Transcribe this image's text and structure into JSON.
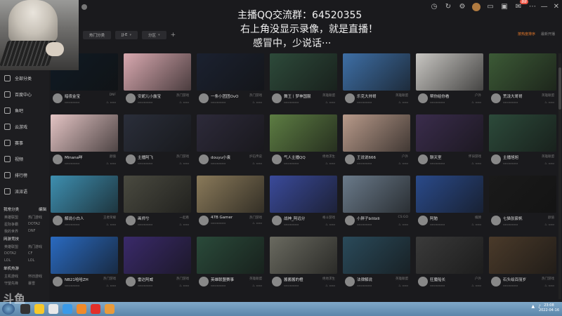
{
  "announcement": {
    "line1": "主播QQ交流群：64520355",
    "line2": "右上角没显示录像，就是直播！",
    "line3": "感冒中，少说话···"
  },
  "topbar": {
    "notification_count": "88"
  },
  "sidebar": {
    "items": [
      "全部分类",
      "百度中心",
      "鱼吧",
      "云游戏",
      "赛事",
      "视频",
      "排行榜",
      "派派语"
    ],
    "sections": [
      {
        "title": "我常分类",
        "action": "编辑",
        "rows": [
          [
            "英雄联盟",
            "热门游戏"
          ],
          [
            "星际争霸",
            "DOTA2"
          ],
          [
            "我的世界",
            "DNF"
          ]
        ]
      },
      {
        "title": "网游竞技",
        "action": "",
        "rows": [
          [
            "英雄联盟",
            "热门游戏"
          ],
          [
            "DOTA2",
            "CF"
          ],
          [
            "LOL",
            "LOL"
          ]
        ]
      },
      {
        "title": "单机热游",
        "action": "",
        "rows": [
          [
            "主机游戏",
            "怀旧游戏"
          ],
          [
            "守望先锋",
            "暴雪"
          ]
        ]
      }
    ]
  },
  "filters": {
    "chips": [
      "热门分类",
      "JJ-E",
      "分区"
    ],
    "right_tabs": [
      "按热度排序",
      "最新开播"
    ]
  },
  "watermark": "斗鱼",
  "clock": {
    "time": "23:08",
    "date": "2022-04-16"
  },
  "cards": [
    {
      "name": "暗夜金宝",
      "cat": "DNF",
      "bg": "#101a24"
    },
    {
      "name": "安妮儿小露宝",
      "cat": "热门游戏",
      "bg": "#d9a9b0"
    },
    {
      "name": "一条小团团OvO",
      "cat": "热门游戏",
      "bg": "#1b2130"
    },
    {
      "name": "舞王丨梦神国服",
      "cat": "英雄联盟",
      "bg": "#2d4a3a"
    },
    {
      "name": "乐克大帅哥",
      "cat": "英雄联盟",
      "bg": "#3e6fa6"
    },
    {
      "name": "帮你给你看",
      "cat": "户外",
      "bg": "#c8c6c2"
    },
    {
      "name": "荒泷大哥哥",
      "cat": "英雄联盟",
      "bg": "#3c5a36"
    },
    {
      "name": "Minana咩",
      "cat": "颜值",
      "bg": "#e4c4c4"
    },
    {
      "name": "主播阿飞",
      "cat": "热门游戏",
      "bg": "#2a2e3a"
    },
    {
      "name": "douyu小袁",
      "cat": "炉石传说",
      "bg": "#2d2a3a"
    },
    {
      "name": "气人主播QQ",
      "cat": "绝地求生",
      "bg": "#5d7d43"
    },
    {
      "name": "王说说666",
      "cat": "户外",
      "bg": "#b89a8a"
    },
    {
      "name": "聊天室",
      "cat": "怀旧游戏",
      "bg": "#3a2c4c"
    },
    {
      "name": "主播旭旭",
      "cat": "英雄联盟",
      "bg": "#2c4a3a"
    },
    {
      "name": "解说小白人",
      "cat": "王者荣耀",
      "bg": "#3e8fb0"
    },
    {
      "name": "画师兮",
      "cat": "一起看",
      "bg": "#4a4a40"
    },
    {
      "name": "47B Gamer",
      "cat": "热门游戏",
      "bg": "#8a7a5a"
    },
    {
      "name": "战神_阿远分",
      "cat": "格斗游戏",
      "bg": "#3a4a9a"
    },
    {
      "name": "小胖子bilibili",
      "cat": "CS:GO",
      "bg": "#6a7a8a"
    },
    {
      "name": "阿勉",
      "cat": "棋牌",
      "bg": "#2a4a8a"
    },
    {
      "name": "七猫张宸帆",
      "cat": "颜值",
      "bg": "#1a1a1a"
    },
    {
      "name": "NB21哈哈ZH",
      "cat": "热门游戏",
      "bg": "#2a6ac0"
    },
    {
      "name": "雷达阿威",
      "cat": "热门游戏",
      "bg": "#3a2a6a"
    },
    {
      "name": "英雄联盟赛事",
      "cat": "英雄联盟",
      "bg": "#2a4a3a"
    },
    {
      "name": "酱酱酱的橙",
      "cat": "绝地求生",
      "bg": "#6a6a60"
    },
    {
      "name": "法律解说",
      "cat": "英雄联盟",
      "bg": "#2a4a5a"
    },
    {
      "name": "狂魔船长",
      "cat": "户外",
      "bg": "#3a3a3a"
    },
    {
      "name": "石头绘百丽岁",
      "cat": "热门游戏",
      "bg": "#4a3a2a"
    }
  ]
}
